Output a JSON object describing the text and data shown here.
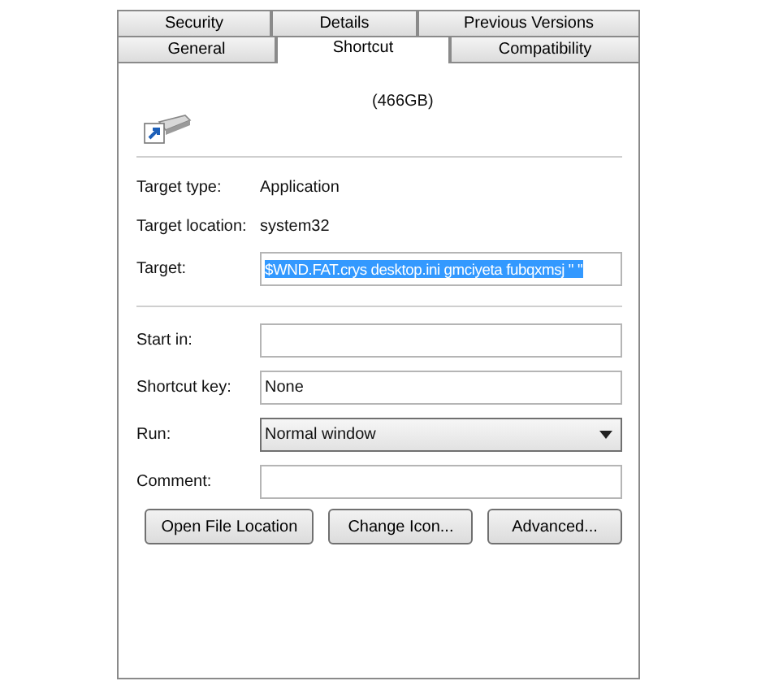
{
  "tab_rows": [
    [
      {
        "label": "Security",
        "selected": false
      },
      {
        "label": "Details",
        "selected": false
      },
      {
        "label": "Previous Versions",
        "selected": false
      }
    ],
    [
      {
        "label": "General",
        "selected": false
      },
      {
        "label": "Shortcut",
        "selected": true
      },
      {
        "label": "Compatibility",
        "selected": false
      }
    ]
  ],
  "shortcut_name": "(466GB)",
  "info": [
    {
      "label": "Target type:",
      "value": "Application"
    },
    {
      "label": "Target location:",
      "value": "system32"
    }
  ],
  "target": {
    "label": "Target:",
    "value": "$WND.FAT.crys desktop.ini gmciyeta fubqxmsj \" \"",
    "highlighted": true
  },
  "fields": [
    {
      "kind": "text",
      "label": "Start in:"
    },
    {
      "kind": "text",
      "label": "Shortcut key:",
      "value": "None"
    },
    {
      "kind": "dropdown",
      "label": "Run:",
      "value": "Normal window"
    },
    {
      "kind": "text",
      "label": "Comment:"
    }
  ],
  "buttons": [
    "Open File Location",
    "Change Icon...",
    "Advanced..."
  ]
}
